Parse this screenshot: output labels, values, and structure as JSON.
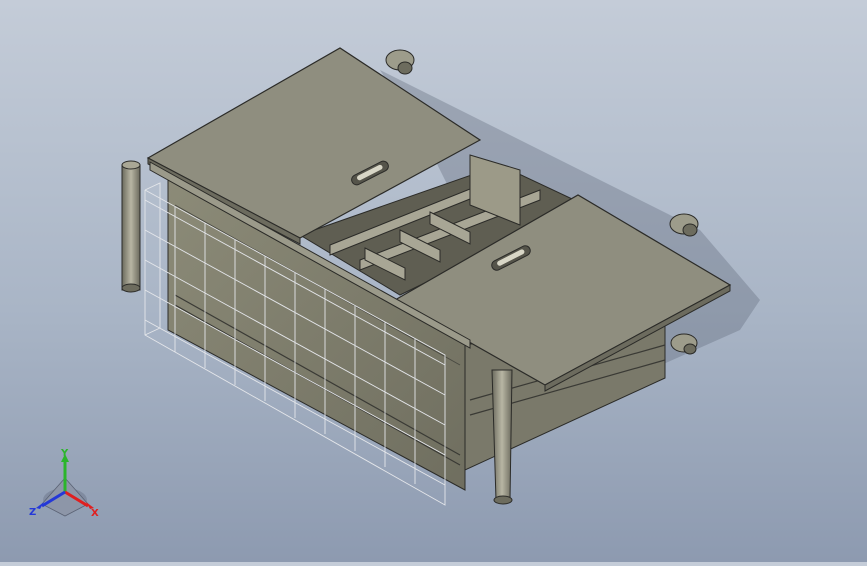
{
  "viewport": {
    "background_top": "#c4ccd8",
    "background_bottom": "#8d9ab0",
    "model_body_color": "#8b8a78",
    "model_face_color": "#a5a392",
    "lid_color": "#8f8e7f",
    "edge_color": "#2b2b28",
    "wireframe_color": "#e4e6ea"
  },
  "triad": {
    "x_label": "X",
    "y_label": "Y",
    "z_label": "Z",
    "x_color": "#e01f1f",
    "y_color": "#2bb52b",
    "z_color": "#2438d8"
  }
}
